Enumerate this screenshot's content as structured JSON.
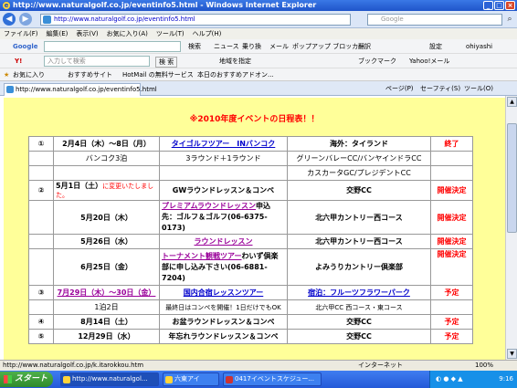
{
  "window": {
    "title": "http://www.naturalgolf.co.jp/eventinfo5.html - Windows Internet Explorer"
  },
  "address": {
    "url": "http://www.naturalgolf.co.jp/eventinfo5.html",
    "search_placeholder": "Google"
  },
  "menu": [
    "ファイル(F)",
    "編集(E)",
    "表示(V)",
    "お気に入り(A)",
    "ツール(T)",
    "ヘルプ(H)"
  ],
  "google_toolbar": {
    "logo": "Google",
    "search_btn": "検索",
    "items": [
      "ニュース",
      "乗り換",
      "メール",
      "ポップアップ ブロッカー",
      "翻訳",
      "設定"
    ],
    "user": "ohiyashi"
  },
  "yahoo_toolbar": {
    "logo": "Y!",
    "input_placeholder": "入力して検索",
    "search_btn": "検 索",
    "items": [
      "地域を指定",
      "ブックマーク",
      "Yahoo!メール"
    ]
  },
  "favorites_bar": {
    "favorites": "お気に入り",
    "items": [
      "おすすめサイト",
      "HotMail の無料サービス",
      "本日のおすすめアドオン..."
    ]
  },
  "tab": {
    "label": "http://www.naturalgolf.co.jp/eventinfo5.html"
  },
  "command_bar": [
    "ページ(P)",
    "セーフティ(S)",
    "ツール(O)"
  ],
  "page": {
    "heading": "※2010年度イベントの日程表！！",
    "table1": [
      {
        "num": "①",
        "date": "2月4日（木）〜8日（月）",
        "event": "タイゴルフツアー　INバンコク",
        "place": "海外：タイランド",
        "status": "終了"
      },
      {
        "num": "",
        "date": "バンコク3泊",
        "event": "3ラウンド＋1ラウンド",
        "place": "グリーンバレーCC/バンヤインドラCC",
        "status": ""
      },
      {
        "num": "",
        "date": "",
        "event": "",
        "place": "カスカータGC/プレジデントCC",
        "status": ""
      },
      {
        "num": "②",
        "date": "5月1日（土）",
        "date_note": "に変更いたしました。",
        "event": "GWラウンドレッスン＆コンペ",
        "place": "交野CC",
        "status": "開催決定"
      },
      {
        "num": "",
        "date": "5月20日（木）",
        "event": "プレミアムラウンドレッスン",
        "event_suffix": "申込先：ゴルフ＆ゴルフ(06-6375-0173)",
        "place": "北六甲カントリー西コース",
        "status": "開催決定"
      },
      {
        "num": "",
        "date": "5月26日（水）",
        "event": "ラウンドレッスン",
        "place": "北六甲カントリー西コース",
        "status": "開催決定"
      }
    ],
    "table2": [
      {
        "num": "",
        "date": "6月25日（金）",
        "event": "トーナメント観戦ツアー",
        "event_suffix": "わいず倶楽部に申し込み下さい(06-6881-7204)",
        "place": "よみうりカントリー倶楽部",
        "status": "開催決定"
      },
      {
        "num": "③",
        "date": "7月29日（木）〜30日（金）",
        "event": "国内合宿レッスンツアー",
        "place": "宿泊：フルーツフラワーパーク",
        "status": "予定"
      },
      {
        "num": "",
        "date": "1泊2日",
        "event": "最終日はコンペを開催！1日だけでもOK",
        "place": "北六甲CC 西コース・東コース",
        "status": ""
      },
      {
        "num": "④",
        "date": "8月14日（土）",
        "event": "お盆ラウンドレッスン＆コンペ",
        "place": "交野CC",
        "status": "予定"
      },
      {
        "num": "⑤",
        "date": "12月29日（水）",
        "event": "年忘れラウンドレッスン＆コンペ",
        "place": "交野CC",
        "status": "予定"
      }
    ]
  },
  "status": {
    "text": "http://www.naturalgolf.co.jp/k.itarokkou.htm",
    "zone": "インターネット",
    "zoom": "100%"
  },
  "taskbar": {
    "start": "スタート",
    "items": [
      "http://www.naturalgol...",
      "六東アイ",
      "0417イベントスケジュー..."
    ],
    "clock": "9:16"
  }
}
